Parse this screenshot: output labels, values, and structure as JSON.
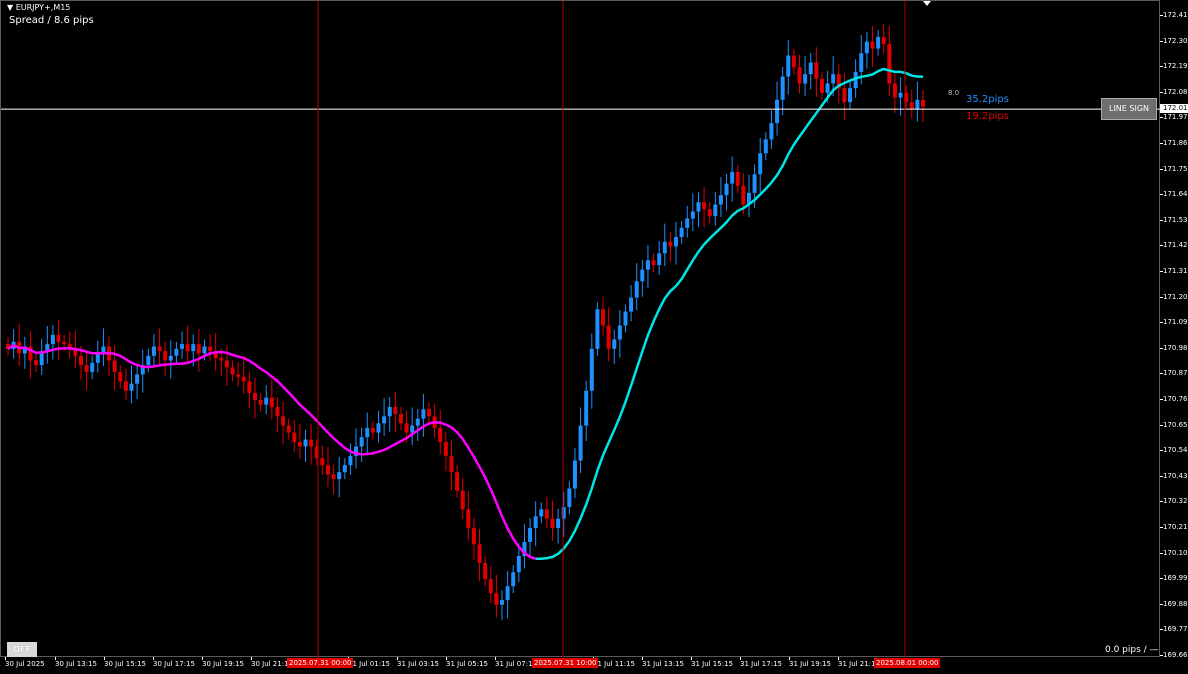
{
  "header": {
    "symbol_label": "EURJPY+,M15",
    "spread_text": "Spread / 8.6 pips"
  },
  "overlay": {
    "spread_value": "8.0",
    "pips_up": "35.2pips",
    "pips_down": "19.2pips",
    "line_sign_label": "LINE SIGN",
    "off_label": "OFF",
    "pips_status": "0.0 pips / —"
  },
  "current_price": "172.01",
  "price_axis": [
    "172.41",
    "172.30",
    "172.19",
    "172.08",
    "171.97",
    "171.86",
    "171.75",
    "171.64",
    "171.53",
    "171.42",
    "171.31",
    "171.20",
    "171.09",
    "170.98",
    "170.87",
    "170.76",
    "170.65",
    "170.54",
    "170.43",
    "170.32",
    "170.21",
    "170.10",
    "169.99",
    "169.88",
    "169.77",
    "169.66"
  ],
  "time_axis": [
    "30 Jul 2025",
    "30 Jul 13:15",
    "30 Jul 15:15",
    "30 Jul 17:15",
    "30 Jul 19:15",
    "30 Jul 21:15",
    "31 Jul 01:15",
    "31 Jul 03:15",
    "31 Jul 05:15",
    "31 Jul 07:15",
    "31 Jul 11:15",
    "31 Jul 13:15",
    "31 Jul 15:15",
    "31 Jul 17:15",
    "31 Jul 19:15",
    "31 Jul 21:15"
  ],
  "time_highlights": [
    "2025.07.31 00:00",
    "2025.07.31 10:00",
    "2025.08.01 00:00"
  ],
  "colors": {
    "bull": "#1e90ff",
    "bear": "#e00000",
    "ma_down": "#ff00ff",
    "ma_up": "#00e5e5",
    "vline": "#b00000",
    "hline": "#ffffff"
  },
  "chart_data": {
    "type": "candlestick",
    "ylim": [
      169.66,
      172.41
    ],
    "series": [
      {
        "name": "EURJPY+,M15",
        "close": [
          170.98,
          171.01,
          170.96,
          170.99,
          170.93,
          170.91,
          170.97,
          171.0,
          171.04,
          171.01,
          171.0,
          170.98,
          170.95,
          170.91,
          170.88,
          170.92,
          170.96,
          170.99,
          170.93,
          170.88,
          170.84,
          170.8,
          170.83,
          170.87,
          170.91,
          170.95,
          170.99,
          170.97,
          170.93,
          170.95,
          170.98,
          171.0,
          170.97,
          171.0,
          170.96,
          170.99,
          170.97,
          170.94,
          170.93,
          170.9,
          170.87,
          170.86,
          170.84,
          170.79,
          170.76,
          170.74,
          170.77,
          170.73,
          170.69,
          170.65,
          170.62,
          170.58,
          170.56,
          170.59,
          170.56,
          170.51,
          170.48,
          170.44,
          170.42,
          170.45,
          170.48,
          170.52,
          170.56,
          170.6,
          170.64,
          170.62,
          170.66,
          170.69,
          170.73,
          170.7,
          170.66,
          170.62,
          170.65,
          170.68,
          170.72,
          170.69,
          170.64,
          170.58,
          170.52,
          170.45,
          170.37,
          170.29,
          170.21,
          170.14,
          170.06,
          169.99,
          169.93,
          169.88,
          169.9,
          169.96,
          170.02,
          170.09,
          170.15,
          170.21,
          170.26,
          170.29,
          170.25,
          170.21,
          170.25,
          170.3,
          170.38,
          170.5,
          170.65,
          170.8,
          170.98,
          171.15,
          171.08,
          170.98,
          171.02,
          171.08,
          171.14,
          171.2,
          171.27,
          171.32,
          171.36,
          171.34,
          171.39,
          171.44,
          171.42,
          171.46,
          171.5,
          171.54,
          171.57,
          171.61,
          171.58,
          171.55,
          171.6,
          171.64,
          171.69,
          171.74,
          171.68,
          171.6,
          171.65,
          171.73,
          171.82,
          171.88,
          171.95,
          172.05,
          172.15,
          172.24,
          172.19,
          172.12,
          172.16,
          172.21,
          172.14,
          172.08,
          172.12,
          172.16,
          172.1,
          172.04,
          172.1,
          172.17,
          172.25,
          172.3,
          172.27,
          172.32,
          172.29,
          172.12,
          172.06,
          172.08,
          172.04,
          172.01,
          172.05,
          172.02
        ]
      }
    ]
  }
}
